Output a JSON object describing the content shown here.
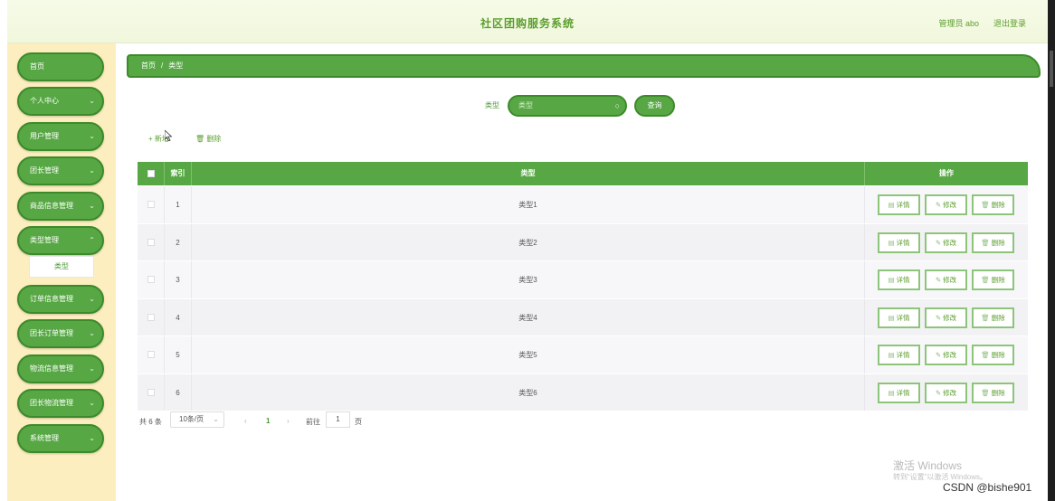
{
  "header": {
    "title": "社区团购服务系统",
    "user": "管理员 abo",
    "logout": "退出登录"
  },
  "sidebar": {
    "items": [
      {
        "label": "首页"
      },
      {
        "label": "个人中心"
      },
      {
        "label": "用户管理"
      },
      {
        "label": "团长管理"
      },
      {
        "label": "商品信息管理"
      },
      {
        "label": "类型管理"
      },
      {
        "label": "订单信息管理"
      },
      {
        "label": "团长订单管理"
      },
      {
        "label": "物流信息管理"
      },
      {
        "label": "团长物流管理"
      },
      {
        "label": "系统管理"
      }
    ],
    "submenu": "类型"
  },
  "breadcrumb": {
    "home": "首页",
    "separator": "/",
    "current": "类型"
  },
  "search": {
    "label": "类型",
    "placeholder": "类型",
    "button": "查询"
  },
  "toolbar": {
    "add": "+ 新增",
    "delete": "🗑 删除"
  },
  "table": {
    "columns": [
      "索引",
      "类型",
      "操作"
    ],
    "rows": [
      {
        "index": "1",
        "type": "类型1"
      },
      {
        "index": "2",
        "type": "类型2"
      },
      {
        "index": "3",
        "type": "类型3"
      },
      {
        "index": "4",
        "type": "类型4"
      },
      {
        "index": "5",
        "type": "类型5"
      },
      {
        "index": "6",
        "type": "类型6"
      }
    ],
    "actions": {
      "detail": "详情",
      "edit": "修改",
      "delete": "删除"
    }
  },
  "pagination": {
    "total": "共 6 条",
    "page_size": "10条/页",
    "current_page": "1",
    "goto_label": "前往",
    "goto_value": "1",
    "page_suffix": "页"
  },
  "overlay": {
    "activate_title": "激活 Windows",
    "activate_hint": "转到“设置”以激活 Windows。",
    "csdn": "CSDN @bishe901"
  }
}
